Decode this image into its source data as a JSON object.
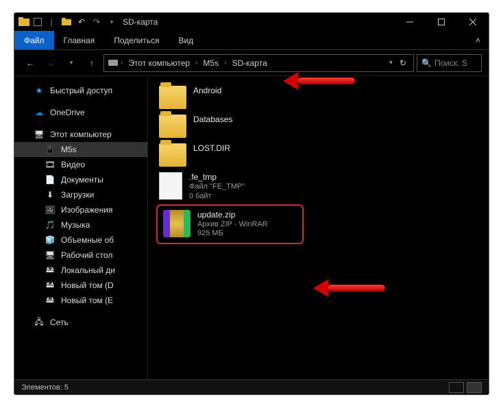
{
  "window": {
    "title": "SD-карта"
  },
  "ribbon": {
    "file": "Файл",
    "tabs": [
      "Главная",
      "Поделиться",
      "Вид"
    ]
  },
  "breadcrumbs": [
    "Этот компьютер",
    "M5s",
    "SD-карта"
  ],
  "search": {
    "placeholder": "Поиск: S"
  },
  "sidebar": {
    "quick_access": "Быстрый доступ",
    "onedrive": "OneDrive",
    "this_pc": "Этот компьютер",
    "items": [
      "M5s",
      "Видео",
      "Документы",
      "Загрузки",
      "Изображения",
      "Музыка",
      "Объемные об",
      "Рабочий стол",
      "Локальный ди",
      "Новый том (D",
      "Новый том (E"
    ],
    "network": "Сеть"
  },
  "files": [
    {
      "name": "Android",
      "type": "folder"
    },
    {
      "name": "Databases",
      "type": "folder"
    },
    {
      "name": "LOST.DIR",
      "type": "folder"
    },
    {
      "name": ".fe_tmp",
      "type": "file",
      "meta1": "Файл \"FE_TMP\"",
      "meta2": "0 байт"
    },
    {
      "name": "update.zip",
      "type": "zip",
      "meta1": "Архив ZIP - WinRAR",
      "meta2": "925 МБ"
    }
  ],
  "status": {
    "count_label": "Элементов:",
    "count": "5"
  }
}
